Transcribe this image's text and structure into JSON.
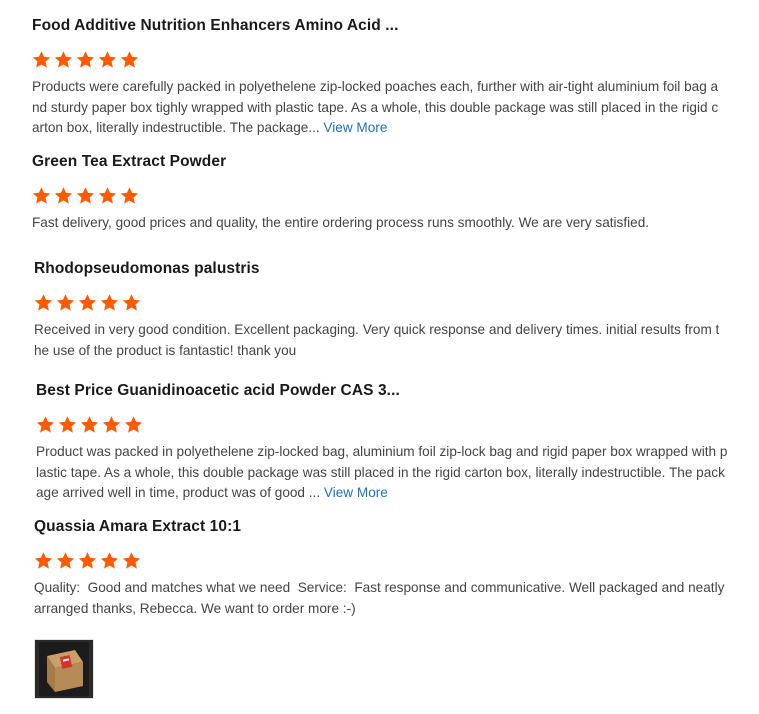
{
  "colors": {
    "star": "#ff5a00",
    "title": "#1a1a1a",
    "body_text": "#444444",
    "link": "#1f6fc6"
  },
  "reviews": [
    {
      "title": "Food Additive Nutrition Enhancers Amino Acid ...",
      "rating": 5,
      "text": "Products were carefully packed in polyethelene zip-locked poaches each, further with air-tight aluminium foil bag and sturdy paper box tighly wrapped with plastic tape. As a whole, this double package was still placed in the rigid carton box, literally indestructible. The package... ",
      "view_more": "View More"
    },
    {
      "title": "Green Tea Extract Powder",
      "rating": 5,
      "text": "Fast delivery, good prices and quality, the entire ordering process runs smoothly. We are very satisfied."
    },
    {
      "title": "Rhodopseudomonas palustris",
      "rating": 5,
      "text": "Received in very good condition. Excellent packaging. Very quick response and delivery times. initial results from the use of the product is fantastic! thank you"
    },
    {
      "title": "Best Price Guanidinoacetic acid Powder CAS 3...",
      "rating": 5,
      "text": "Product was packed in polyethelene zip-locked bag, aluminium foil zip-lock bag and rigid paper box wrapped with plastic tape. As a whole, this double package was still placed in the rigid carton box, literally indestructible. The package arrived well in time, product was of good ... ",
      "view_more": "View More"
    },
    {
      "title": "Quassia Amara Extract 10:1",
      "rating": 5,
      "text": "Quality:  Good and matches what we need  Service:  Fast response and communicative. Well packaged and neatly arranged thanks, Rebecca. We want to order more :-)"
    }
  ],
  "photo": {
    "icon": "product-photo-thumbnail"
  }
}
